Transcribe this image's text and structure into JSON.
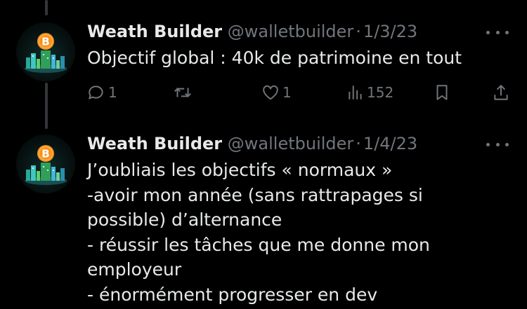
{
  "tweets": [
    {
      "author": "Weath Builder",
      "handle": "@walletbuilder",
      "separator": "·",
      "date": "1/3/23",
      "lines": [
        "Objectif global : 40k de patrimoine en tout"
      ],
      "replies": "1",
      "likes": "1",
      "views": "152"
    },
    {
      "author": "Weath Builder",
      "handle": "@walletbuilder",
      "separator": "·",
      "date": "1/4/23",
      "lines": [
        "J’oubliais les objectifs « normaux »",
        "-avoir mon année (sans rattrapages si",
        "possible) d’alternance",
        "- réussir les tâches que me donne mon",
        "employeur",
        "- énormément progresser en dev"
      ]
    }
  ],
  "avatar_symbol": "B",
  "colors": {
    "background": "#000000",
    "text": "#e7e9ea",
    "muted": "#71767b",
    "thread_line": "#333639",
    "bitcoin_orange": "#f7931a"
  },
  "icons": [
    "reply-icon",
    "retweet-icon",
    "like-icon",
    "views-icon",
    "bookmark-icon",
    "share-icon",
    "more-icon"
  ]
}
